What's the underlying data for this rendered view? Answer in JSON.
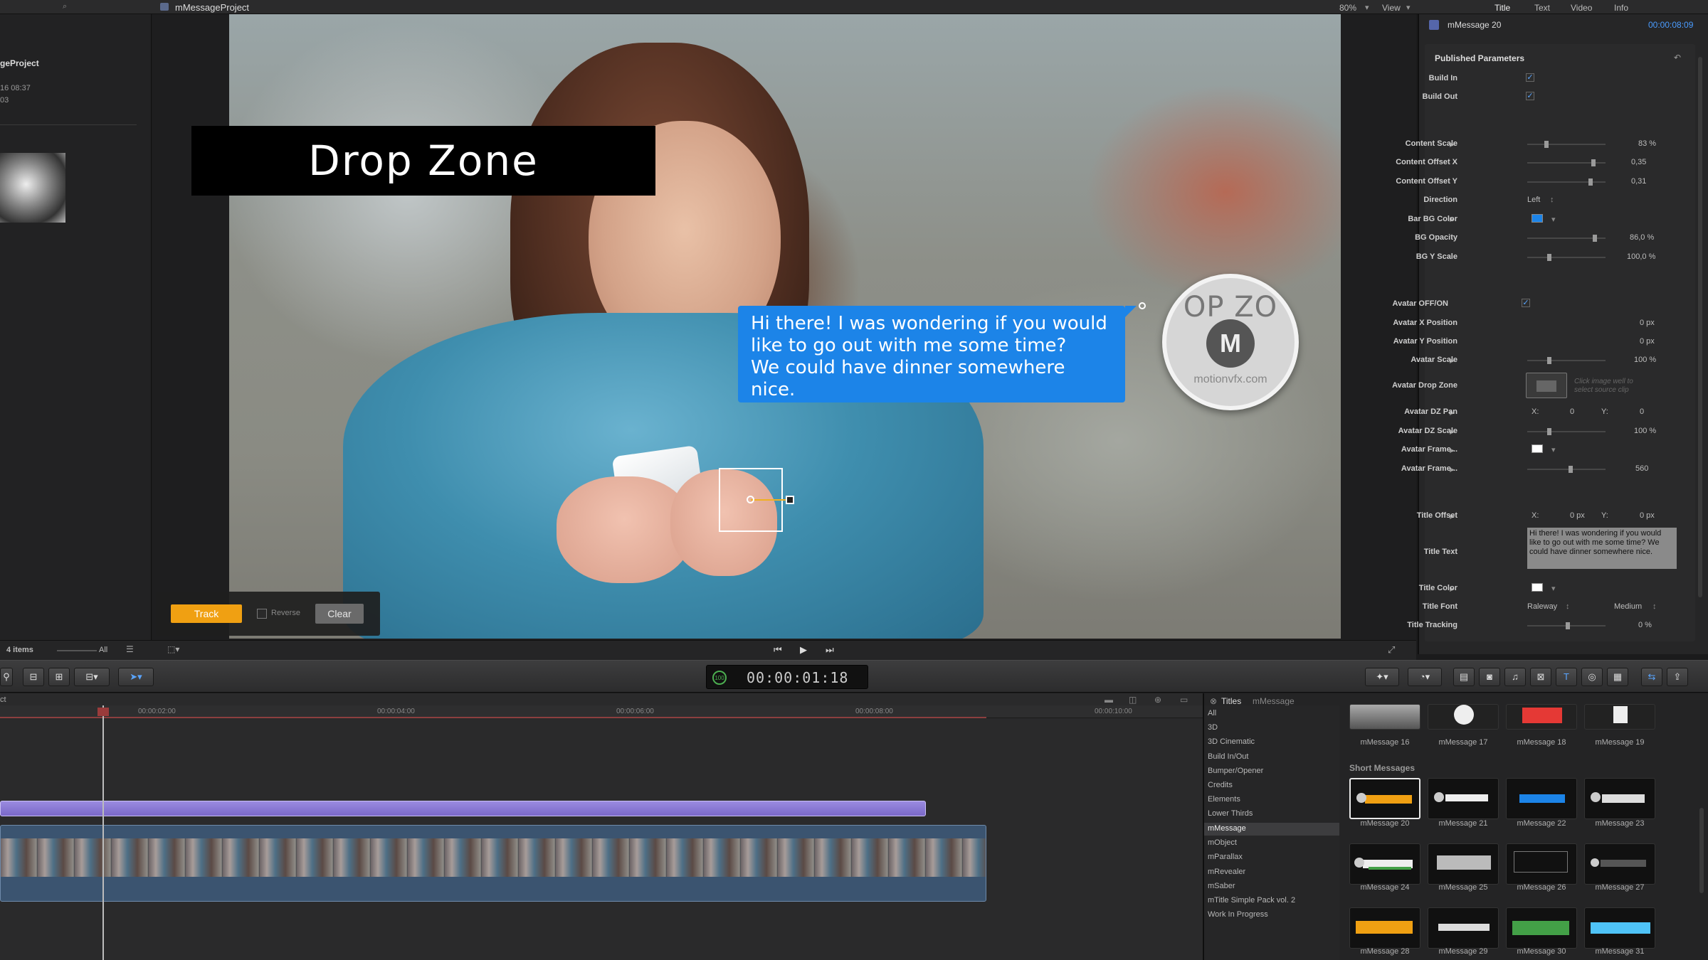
{
  "topbar": {
    "project_title": "mMessageProject",
    "zoom": "80%",
    "view_menu": "View",
    "inspector_tabs": [
      "Title",
      "Text",
      "Video",
      "Info"
    ]
  },
  "library": {
    "project_name": "geProject",
    "date": "16 08:37",
    "line3": "03",
    "items_count": "4 items",
    "all_label": "All"
  },
  "viewer": {
    "dropzone_text": "Drop Zone",
    "bubble_lines": [
      "Hi there! I was wondering if you would",
      "like to go out with me some time?",
      "We could have dinner somewhere nice."
    ],
    "avatar_text": "OP ZO",
    "avatar_logo": "M",
    "avatar_url": "motionvfx.com",
    "track_label": "Track",
    "reverse_label": "Reverse",
    "clear_label": "Clear"
  },
  "toolbar": {
    "timecode": "00:00:01:18",
    "timecode_badge": "100"
  },
  "timeline": {
    "ruler_ticks": [
      "00:00:02:00",
      "00:00:04:00",
      "00:00:06:00",
      "00:00:08:00",
      "00:00:10:00"
    ],
    "corner_label": "ct"
  },
  "browser": {
    "header": "Titles",
    "header_sub": "mMessage",
    "categories": [
      "All",
      "3D",
      "3D Cinematic",
      "Build In/Out",
      "Bumper/Opener",
      "Credits",
      "Elements",
      "Lower Thirds",
      "mMessage",
      "mObject",
      "mParallax",
      "mRevealer",
      "mSaber",
      "mTitle Simple Pack vol. 2",
      "Work In Progress"
    ],
    "selected_category": "mMessage",
    "section_label": "Short Messages",
    "row0": [
      "mMessage 16",
      "mMessage 17",
      "mMessage 18",
      "mMessage 19"
    ],
    "row1": [
      "mMessage 20",
      "mMessage 21",
      "mMessage 22",
      "mMessage 23"
    ],
    "row2": [
      "mMessage 24",
      "mMessage 25",
      "mMessage 26",
      "mMessage 27"
    ],
    "row3": [
      "mMessage 28",
      "mMessage 29",
      "mMessage 30",
      "mMessage 31"
    ]
  },
  "inspector": {
    "clip_name": "mMessage 20",
    "clip_time": "00:00:08:09",
    "section": "Published Parameters",
    "build_in": "Build In",
    "build_out": "Build Out",
    "content_scale": "Content Scale",
    "content_scale_val": "83 %",
    "content_offset_x": "Content Offset X",
    "content_offset_x_val": "0,35",
    "content_offset_y": "Content Offset Y",
    "content_offset_y_val": "0,31",
    "direction": "Direction",
    "direction_val": "Left",
    "bar_bg_color": "Bar BG Color",
    "bg_opacity": "BG Opacity",
    "bg_opacity_val": "86,0 %",
    "bg_y_scale": "BG Y Scale",
    "bg_y_scale_val": "100,0 %",
    "avatar_onoff": "Avatar OFF/ON",
    "avatar_x": "Avatar X Position",
    "avatar_x_val": "0 px",
    "avatar_y": "Avatar Y Position",
    "avatar_y_val": "0 px",
    "avatar_scale": "Avatar Scale",
    "avatar_scale_val": "100 %",
    "avatar_drop_zone": "Avatar Drop Zone",
    "drop_hint": "Click image well to select source clip",
    "avatar_dz_pan": "Avatar DZ Pan",
    "dz_pan_x": "X:",
    "dz_pan_x_val": "0",
    "dz_pan_y": "Y:",
    "dz_pan_y_val": "0",
    "avatar_dz_scale": "Avatar DZ Scale",
    "avatar_dz_scale_val": "100 %",
    "avatar_frame1": "Avatar Frame...",
    "avatar_frame2": "Avatar Frame...",
    "avatar_frame2_val": "560",
    "title_offset": "Title Offset",
    "title_offset_x": "X:",
    "title_offset_x_val": "0 px",
    "title_offset_y": "Y:",
    "title_offset_y_val": "0 px",
    "title_text": "Title Text",
    "title_text_val": "Hi there! I was wondering if you would like to go out with me some time? We could have dinner somewhere nice.",
    "title_color": "Title Color",
    "title_font": "Title Font",
    "title_font_val": "Raleway",
    "title_font_weight": "Medium",
    "title_tracking": "Title Tracking",
    "title_tracking_val": "0 %",
    "colors": {
      "accent": "#1c84e8",
      "track": "#f0a012"
    }
  }
}
